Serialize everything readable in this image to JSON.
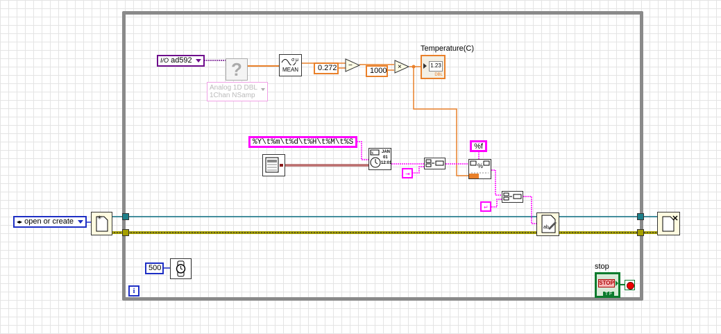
{
  "channel_control": {
    "value": "ad592",
    "prefix": "I/O"
  },
  "daq_polymorphic": {
    "line1": "Analog 1D DBL",
    "line2": "1Chan NSamp"
  },
  "mean_block": {
    "label": "MEAN"
  },
  "offset_constant": {
    "value": "0.272"
  },
  "scale_constant": {
    "value": "1000"
  },
  "temperature_indicator": {
    "label": "Temperature(C)",
    "display": "1.23",
    "type": "DBL"
  },
  "format_string_constant": {
    "value": "%Y\\t%m\\t%d\\t%H\\t%M\\t%S"
  },
  "float_format_constant": {
    "value": "%f"
  },
  "file_operation_control": {
    "value": "open or create"
  },
  "wait_constant": {
    "value": "500"
  },
  "stop_control": {
    "label": "stop",
    "button_text": "STOP",
    "tf": "T F"
  },
  "iteration_terminal": {
    "label": "i"
  },
  "clock_node": {
    "line1": "JAN",
    "line2": "01",
    "line3": "12:01"
  },
  "colors": {
    "frame": "#8a8a8a",
    "dbl_wire": "#e9802a",
    "string_wire": "#ff00ff",
    "refnum_wire": "#0a6d80",
    "error_wire": "#a6a000",
    "timestamp_wire": "#8a1a1a",
    "waveform_wire": "#6e0c8c"
  }
}
